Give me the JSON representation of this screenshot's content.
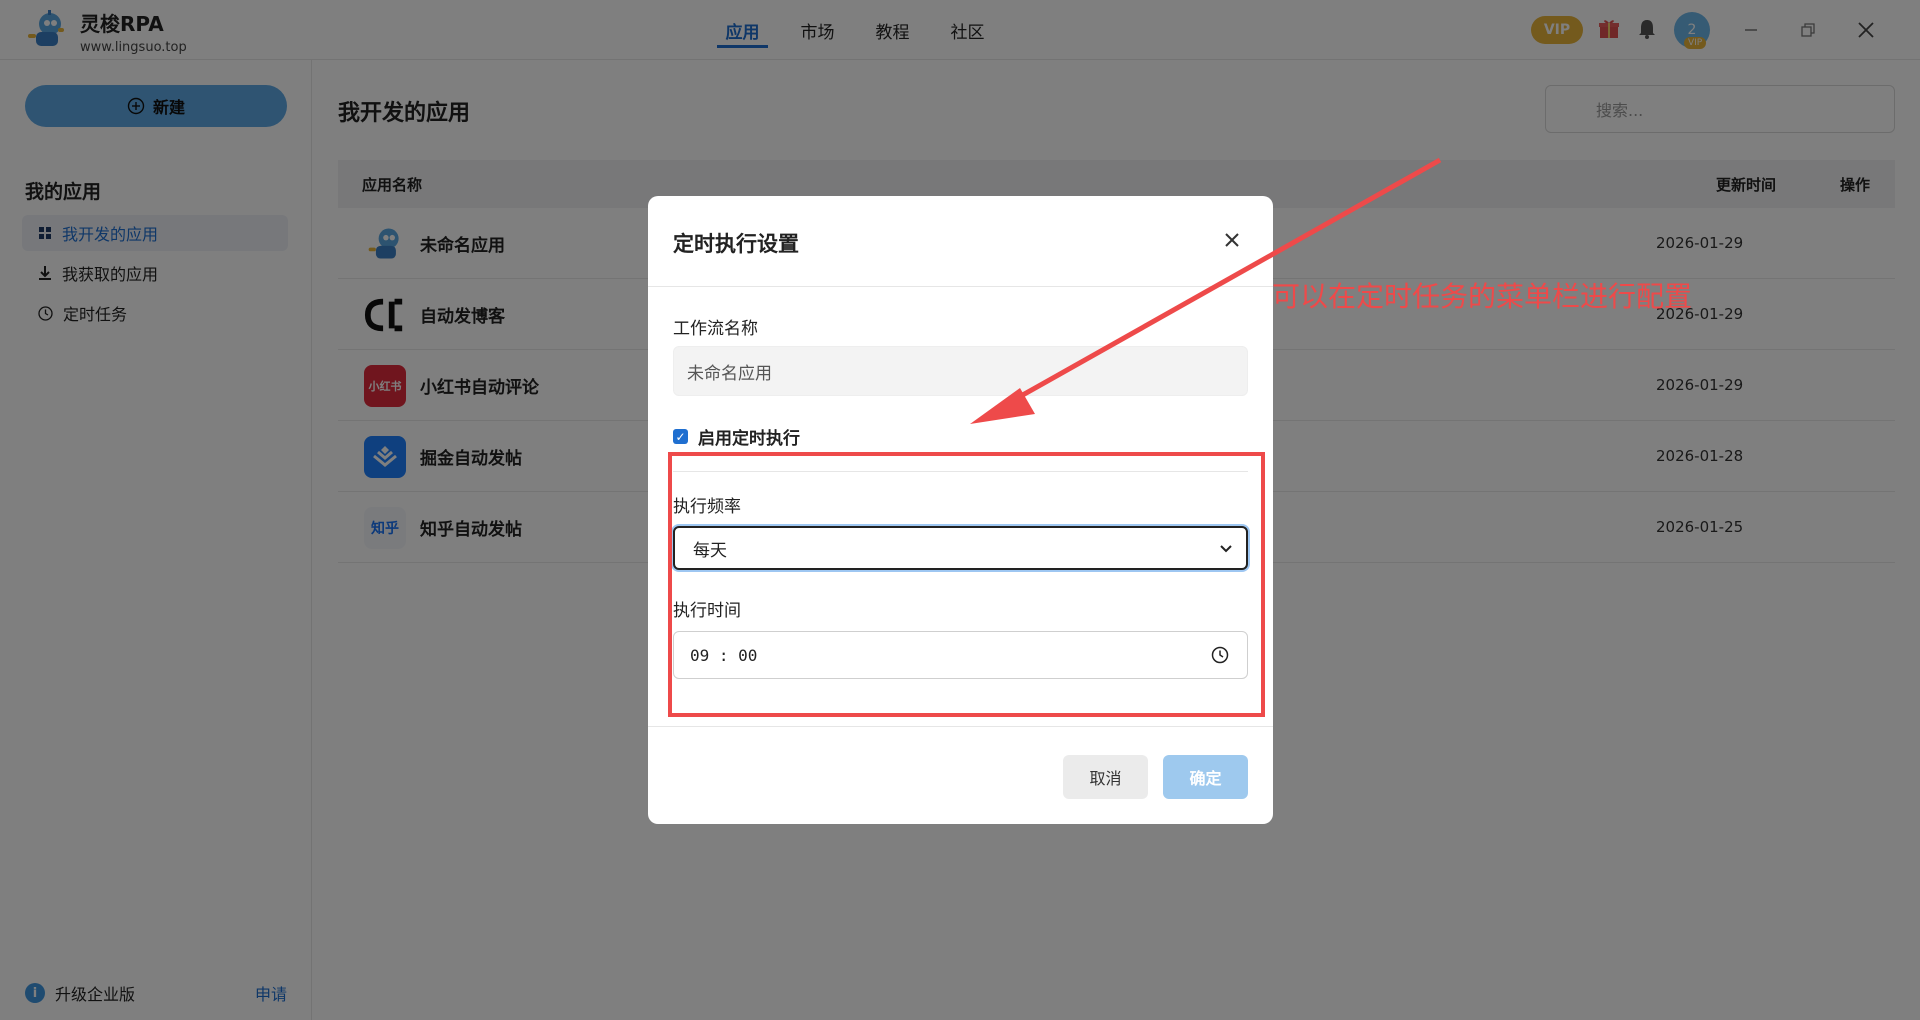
{
  "app": {
    "name": "灵梭RPA",
    "url": "www.lingsuo.top",
    "vip_label": "VIP",
    "avatar_text": "2",
    "avatar_badge": "VIP",
    "accent_color": "#1f6fd0"
  },
  "nav": {
    "tabs": [
      {
        "label": "应用",
        "active": true
      },
      {
        "label": "市场",
        "active": false
      },
      {
        "label": "教程",
        "active": false
      },
      {
        "label": "社区",
        "active": false
      }
    ]
  },
  "sidebar": {
    "new_button": "新建",
    "section_title": "我的应用",
    "items": [
      {
        "label": "我开发的应用",
        "icon": "grid-icon",
        "active": true
      },
      {
        "label": "我获取的应用",
        "icon": "download-icon",
        "active": false
      },
      {
        "label": "定时任务",
        "icon": "clock-icon",
        "active": false
      }
    ],
    "footer": {
      "upgrade_label": "升级企业版",
      "apply_label": "申请"
    }
  },
  "main": {
    "title": "我开发的应用",
    "search_placeholder": "搜索...",
    "columns": {
      "name": "应用名称",
      "updated": "更新时间",
      "actions": "操作"
    },
    "rows": [
      {
        "name": "未命名应用",
        "updated": "2026-01-29",
        "icon": "robot-icon"
      },
      {
        "name": "自动发博客",
        "updated": "2026-01-29",
        "icon": "csdn-icon"
      },
      {
        "name": "小红书自动评论",
        "updated": "2026-01-29",
        "icon": "xiaohongshu-icon",
        "icon_text": "小红书"
      },
      {
        "name": "掘金自动发帖",
        "updated": "2026-01-28",
        "icon": "juejin-icon"
      },
      {
        "name": "知乎自动发帖",
        "updated": "2026-01-25",
        "icon": "zhihu-icon",
        "icon_text": "知乎"
      }
    ]
  },
  "modal": {
    "title": "定时执行设置",
    "workflow_label": "工作流名称",
    "workflow_value": "未命名应用",
    "enable_label": "启用定时执行",
    "enabled": true,
    "frequency_label": "执行频率",
    "frequency_value": "每天",
    "time_label": "执行时间",
    "time_value": "09 : 00",
    "cancel_label": "取消",
    "confirm_label": "确定"
  },
  "annotation": {
    "text": "可以在定时任务的菜单栏进行配置",
    "color": "#ee4a4a"
  }
}
